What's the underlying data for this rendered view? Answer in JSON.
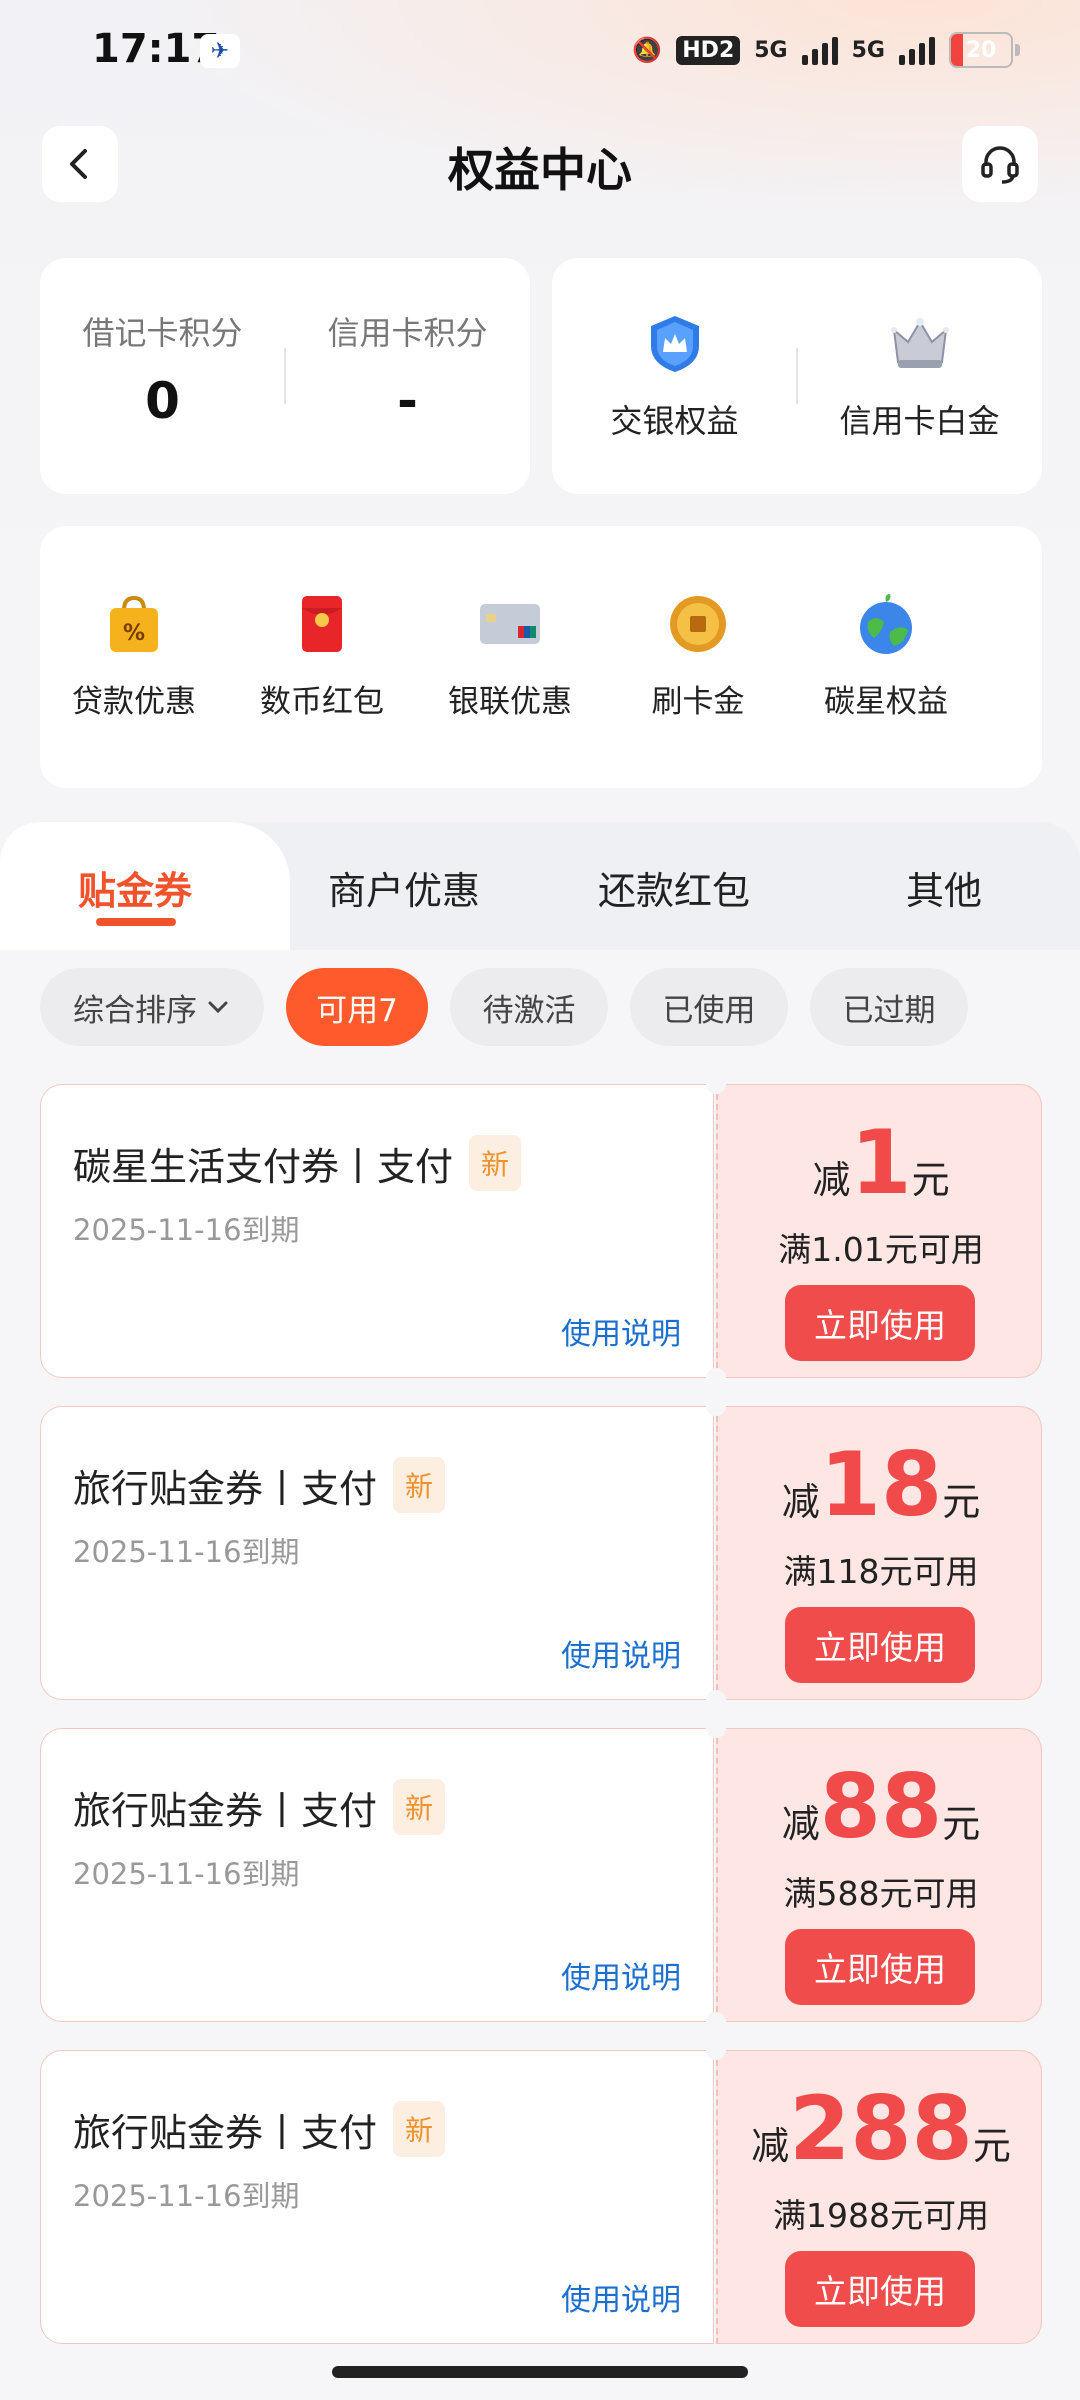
{
  "status_bar": {
    "time": "17:17",
    "hd": "HD2",
    "sig1": "5G",
    "sig2": "5G",
    "battery": "20"
  },
  "header": {
    "title": "权益中心"
  },
  "points": {
    "debit_label": "借记卡积分",
    "debit_value": "0",
    "credit_label": "信用卡积分",
    "credit_value": "-"
  },
  "benefits": [
    {
      "label": "交银权益",
      "icon": "crown-badge-icon"
    },
    {
      "label": "信用卡白金",
      "icon": "silver-crown-icon"
    }
  ],
  "quick": [
    {
      "label": "贷款优惠",
      "icon": "percent-bag-icon"
    },
    {
      "label": "数币红包",
      "icon": "red-envelope-icon"
    },
    {
      "label": "银联优惠",
      "icon": "bank-card-icon"
    },
    {
      "label": "刷卡金",
      "icon": "gold-coin-icon"
    },
    {
      "label": "碳星权益",
      "icon": "globe-icon"
    }
  ],
  "tabs": [
    "贴金券",
    "商户优惠",
    "还款红包",
    "其他"
  ],
  "filters": {
    "sort": "综合排序",
    "chips": [
      "可用7",
      "待激活",
      "已使用",
      "已过期"
    ]
  },
  "coupons": [
    {
      "name": "碳星生活支付券丨支付",
      "tag": "新",
      "date": "2025-11-16到期",
      "info": "使用说明",
      "pre": "减",
      "amount": "1",
      "suf": "元",
      "cond": "满1.01元可用",
      "btn": "立即使用"
    },
    {
      "name": "旅行贴金券丨支付",
      "tag": "新",
      "date": "2025-11-16到期",
      "info": "使用说明",
      "pre": "减",
      "amount": "18",
      "suf": "元",
      "cond": "满118元可用",
      "btn": "立即使用"
    },
    {
      "name": "旅行贴金券丨支付",
      "tag": "新",
      "date": "2025-11-16到期",
      "info": "使用说明",
      "pre": "减",
      "amount": "88",
      "suf": "元",
      "cond": "满588元可用",
      "btn": "立即使用"
    },
    {
      "name": "旅行贴金券丨支付",
      "tag": "新",
      "date": "2025-11-16到期",
      "info": "使用说明",
      "pre": "减",
      "amount": "288",
      "suf": "元",
      "cond": "满1988元可用",
      "btn": "立即使用"
    }
  ],
  "colors": {
    "accent": "#f0522c",
    "coupon_red": "#f04a4a",
    "link_blue": "#1a6fd0"
  }
}
